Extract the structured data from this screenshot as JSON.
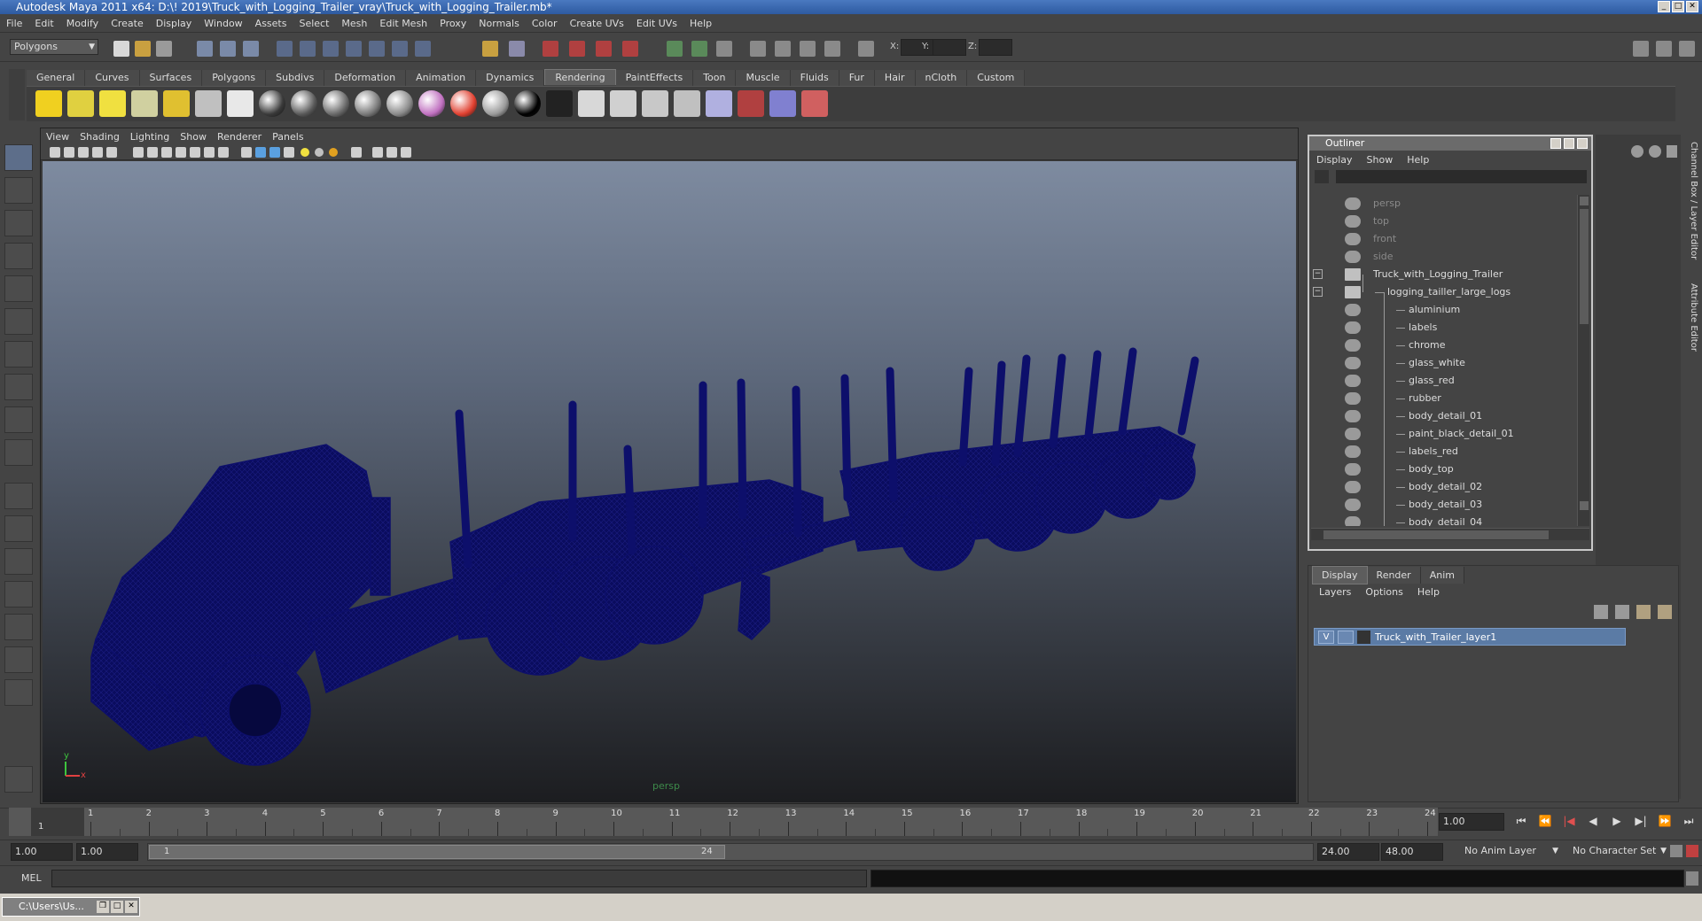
{
  "window": {
    "title": "Autodesk Maya 2011 x64: D:\\! 2019\\Truck_with_Logging_Trailer_vray\\Truck_with_Logging_Trailer.mb*",
    "minimize": "_",
    "maximize": "□",
    "close": "✕"
  },
  "menubar": [
    "File",
    "Edit",
    "Modify",
    "Create",
    "Display",
    "Window",
    "Assets",
    "Select",
    "Mesh",
    "Edit Mesh",
    "Proxy",
    "Normals",
    "Color",
    "Create UVs",
    "Edit UVs",
    "Help"
  ],
  "statusline": {
    "mode": "Polygons",
    "x_label": "X:",
    "y_label": "Y:",
    "z_label": "Z:"
  },
  "shelf": {
    "tabs": [
      "General",
      "Curves",
      "Surfaces",
      "Polygons",
      "Subdivs",
      "Deformation",
      "Animation",
      "Dynamics",
      "Rendering",
      "PaintEffects",
      "Toon",
      "Muscle",
      "Fluids",
      "Fur",
      "Hair",
      "nCloth",
      "Custom"
    ],
    "active_tab": "Rendering",
    "icons": [
      "ambient-light-icon",
      "directional-light-icon",
      "point-light-icon",
      "spot-light-icon",
      "area-light-icon",
      "volume-light-icon",
      "render-layer-icon",
      "blinn-sphere-icon",
      "lambert-sphere-icon",
      "phong-sphere-icon",
      "phonge-sphere-icon",
      "anisotropic-sphere-icon",
      "ramp-shader-icon",
      "color-sphere-icon",
      "gray-sphere-icon",
      "black-sphere-icon",
      "surface-shader-icon",
      "render-view-icon",
      "render-current-icon",
      "ipr-render-icon",
      "batch-render-icon",
      "hypershade-icon",
      "render-settings-icon",
      "render-globe-icon",
      "paint-brush-icon"
    ]
  },
  "viewport": {
    "menu": [
      "View",
      "Shading",
      "Lighting",
      "Show",
      "Renderer",
      "Panels"
    ],
    "camera": "persp",
    "axis_y": "y",
    "axis_x": "x",
    "wire_color": "#0d0f6b"
  },
  "outliner": {
    "title": "Outliner",
    "menu": [
      "Display",
      "Show",
      "Help"
    ],
    "items": [
      {
        "label": "persp",
        "dim": true,
        "indent": 0
      },
      {
        "label": "top",
        "dim": true,
        "indent": 0
      },
      {
        "label": "front",
        "dim": true,
        "indent": 0
      },
      {
        "label": "side",
        "dim": true,
        "indent": 0
      },
      {
        "label": "Truck_with_Logging_Trailer",
        "dim": false,
        "indent": 0,
        "expand": "−"
      },
      {
        "label": "logging_tailler_large_logs",
        "dim": false,
        "indent": 1,
        "expand": "−"
      },
      {
        "label": "aluminium",
        "dim": false,
        "indent": 2
      },
      {
        "label": "labels",
        "dim": false,
        "indent": 2
      },
      {
        "label": "chrome",
        "dim": false,
        "indent": 2
      },
      {
        "label": "glass_white",
        "dim": false,
        "indent": 2
      },
      {
        "label": "glass_red",
        "dim": false,
        "indent": 2
      },
      {
        "label": "rubber",
        "dim": false,
        "indent": 2
      },
      {
        "label": "body_detail_01",
        "dim": false,
        "indent": 2
      },
      {
        "label": "paint_black_detail_01",
        "dim": false,
        "indent": 2
      },
      {
        "label": "labels_red",
        "dim": false,
        "indent": 2
      },
      {
        "label": "body_top",
        "dim": false,
        "indent": 2
      },
      {
        "label": "body_detail_02",
        "dim": false,
        "indent": 2
      },
      {
        "label": "body_detail_03",
        "dim": false,
        "indent": 2
      },
      {
        "label": "body_detail_04",
        "dim": false,
        "indent": 2
      }
    ]
  },
  "right_strip": {
    "channel_box": "Channel Box / Layer Editor",
    "attribute_editor": "Attribute Editor"
  },
  "layer_editor": {
    "tabs": [
      "Display",
      "Render",
      "Anim"
    ],
    "active_tab": "Display",
    "menu": [
      "Layers",
      "Options",
      "Help"
    ],
    "layer": {
      "visible": "V",
      "name": "Truck_with_Trailer_layer1"
    }
  },
  "time_slider": {
    "ticks": [
      "1",
      "2",
      "3",
      "4",
      "5",
      "6",
      "7",
      "8",
      "9",
      "10",
      "11",
      "12",
      "13",
      "14",
      "15",
      "16",
      "17",
      "18",
      "19",
      "20",
      "21",
      "22",
      "23",
      "24"
    ],
    "current_frame_label": "1",
    "current_frame": "1.00",
    "playback_buttons": [
      "⏮",
      "⏪",
      "|◀",
      "◀",
      "▶",
      "▶|",
      "⏩",
      "⏭"
    ]
  },
  "range_slider": {
    "start_time": "1.00",
    "playback_start": "1.00",
    "range_start_label": "1",
    "range_end_label": "24",
    "playback_end": "24.00",
    "end_time": "48.00",
    "anim_layer": "No Anim Layer",
    "character_set": "No Character Set"
  },
  "command_line": {
    "label": "MEL"
  },
  "taskbar": {
    "item": "C:\\Users\\Us..."
  }
}
